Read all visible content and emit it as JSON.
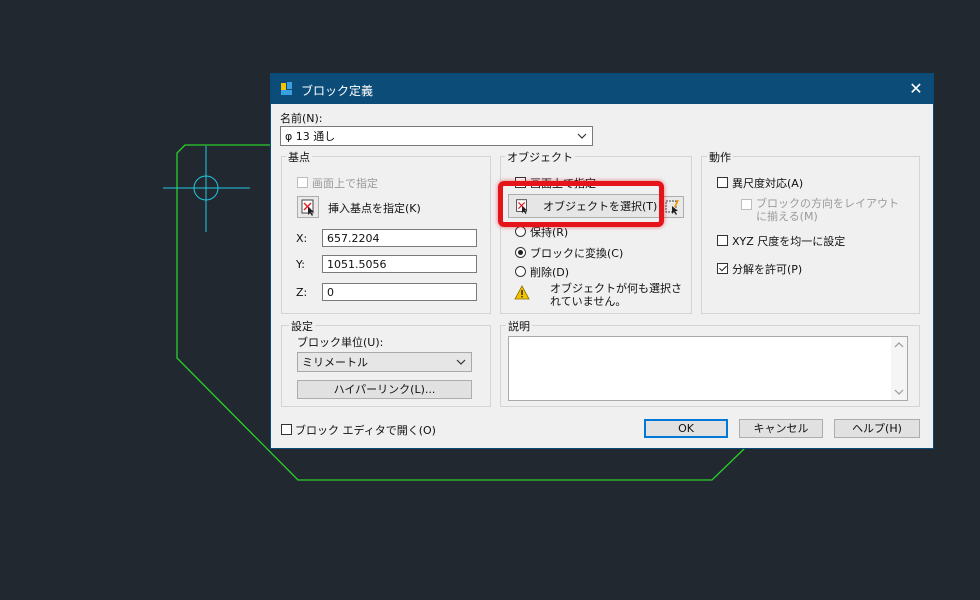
{
  "dialog": {
    "title": "ブロック定義",
    "close_glyph": "✕",
    "name_label": "名前(N):",
    "name_value": "φ 13 通し"
  },
  "base_point": {
    "group_label": "基点",
    "specify_on_screen": "画面上で指定",
    "pick_button": "挿入基点を指定(K)",
    "x_label": "X:",
    "x_value": "657.2204",
    "y_label": "Y:",
    "y_value": "1051.5056",
    "z_label": "Z:",
    "z_value": "0"
  },
  "objects": {
    "group_label": "オブジェクト",
    "specify_on_screen": "画面上で指定",
    "select_button": "オブジェクトを選択(T)",
    "retain": "保持(R)",
    "convert": "ブロックに変換(C)",
    "delete": "削除(D)",
    "warning": "オブジェクトが何も選択されていません。"
  },
  "behavior": {
    "group_label": "動作",
    "annotative": "異尺度対応(A)",
    "match_orientation": "ブロックの方向をレイアウトに揃える(M)",
    "uniform_scale": "XYZ 尺度を均一に設定",
    "allow_explode": "分解を許可(P)"
  },
  "settings": {
    "group_label": "設定",
    "units_label": "ブロック単位(U):",
    "units_value": "ミリメートル",
    "hyperlink_button": "ハイパーリンク(L)..."
  },
  "description": {
    "group_label": "説明"
  },
  "footer": {
    "open_in_editor": "ブロック エディタで開く(O)",
    "ok": "OK",
    "cancel": "キャンセル",
    "help": "ヘルプ(H)"
  },
  "colors": {
    "titlebar": "#0b4d78",
    "cad_background": "#212830",
    "cad_outline": "#2ad02a",
    "cad_crosshair": "#22c8e0",
    "highlight": "#e5141a"
  }
}
